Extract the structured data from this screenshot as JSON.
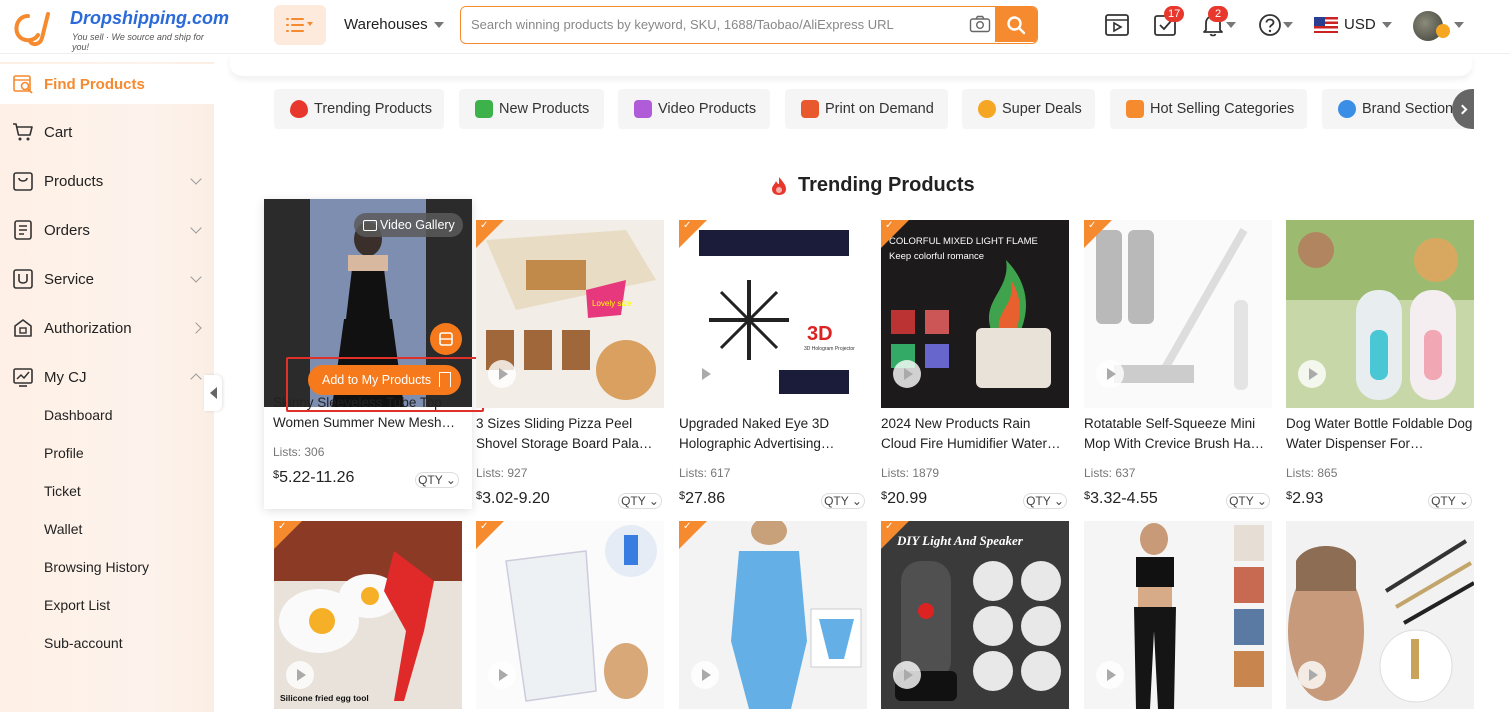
{
  "header": {
    "brand": "Dropshipping.com",
    "tagline": "You sell · We source and ship for you!",
    "warehouses_label": "Warehouses",
    "search_placeholder": "Search winning products by keyword, SKU, 1688/Taobao/AliExpress URL",
    "tasks_count": "17",
    "notifications_count": "2",
    "currency": "USD"
  },
  "sidebar": {
    "items": [
      {
        "label": "Find Products",
        "icon": "find-products-icon",
        "active": true
      },
      {
        "label": "Cart",
        "icon": "cart-icon"
      },
      {
        "label": "Products",
        "icon": "products-icon"
      },
      {
        "label": "Orders",
        "icon": "orders-icon"
      },
      {
        "label": "Service",
        "icon": "service-icon"
      },
      {
        "label": "Authorization",
        "icon": "authorization-icon"
      },
      {
        "label": "My CJ",
        "icon": "chart-icon"
      }
    ],
    "sub_items": [
      "Dashboard",
      "Profile",
      "Ticket",
      "Wallet",
      "Browsing History",
      "Export List",
      "Sub-account"
    ]
  },
  "categories": [
    {
      "label": "Trending Products",
      "color": "#e8382d"
    },
    {
      "label": "New Products",
      "color": "#3db24b"
    },
    {
      "label": "Video Products",
      "color": "#b05cd9"
    },
    {
      "label": "Print on Demand",
      "color": "#e85a2d"
    },
    {
      "label": "Super Deals",
      "color": "#f5a623"
    },
    {
      "label": "Hot Selling Categories",
      "color": "#f68a2e"
    },
    {
      "label": "Brand Section",
      "color": "#3a8ee6"
    }
  ],
  "section": {
    "title": "Trending Products"
  },
  "hover": {
    "video_gallery": "Video Gallery",
    "add_label": "Add to My Products"
  },
  "products_row1": [
    {
      "title": "Skinny Sleeveless Tube Top Women Summer New Mesh…",
      "lists": "Lists: 306",
      "currency": "$",
      "price": "5.22-11.26",
      "qty": "QTY"
    },
    {
      "title": "3 Sizes Sliding Pizza Peel Shovel Storage Board Pala…",
      "lists": "Lists: 927",
      "currency": "$",
      "price": "3.02-9.20",
      "qty": "QTY"
    },
    {
      "title": "Upgraded Naked Eye 3D Holographic Advertising…",
      "lists": "Lists: 617",
      "currency": "$",
      "price": "27.86",
      "qty": "QTY"
    },
    {
      "title": "2024 New Products Rain Cloud Fire Humidifier Water…",
      "lists": "Lists: 1879",
      "currency": "$",
      "price": "20.99",
      "qty": "QTY"
    },
    {
      "title": "Rotatable Self-Squeeze Mini Mop With Crevice Brush Ha…",
      "lists": "Lists: 637",
      "currency": "$",
      "price": "3.32-4.55",
      "qty": "QTY"
    },
    {
      "title": "Dog Water Bottle Foldable Dog Water Dispenser For…",
      "lists": "Lists: 865",
      "currency": "$",
      "price": "2.93",
      "qty": "QTY"
    }
  ],
  "image_text": {
    "pizza_sticker": "Lovely size",
    "hologram_3d": "3D",
    "hologram_sub": "3D Hologram Projector",
    "flame_line1": "COLORFUL MIXED LIGHT FLAME",
    "flame_line2": "Keep colorful romance",
    "egg_caption": "Silicone fried egg tool",
    "speaker_caption": "DIY Light And Speaker"
  }
}
